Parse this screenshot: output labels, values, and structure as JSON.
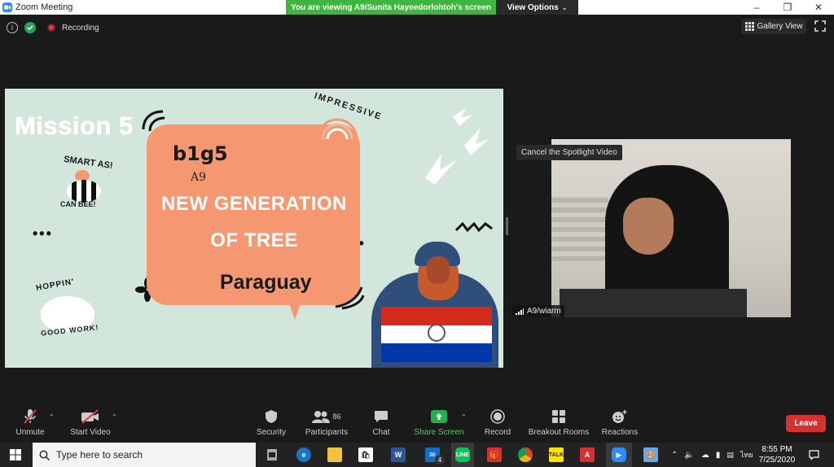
{
  "window": {
    "title": "Zoom Meeting"
  },
  "share_banner": {
    "text": "You are viewing A9/Sunita Hayeedorlohtoh's screen",
    "view_options_label": "View Options"
  },
  "meeting": {
    "recording_label": "Recording",
    "gallery_view_label": "Gallery View"
  },
  "slide": {
    "mission": "Mission 5",
    "group": "b1g5",
    "class": "A9",
    "line1": "NEW GENERATION",
    "line2": "OF TREE",
    "country": "Paraguay",
    "sticker_smart": "SMART AS!",
    "sticker_canbee": "CAN BEE!",
    "sticker_hoppin": "HOPPIN'",
    "sticker_goodwork": "GOOD WORK!",
    "sticker_impressive": "IMPRESSIVE",
    "flag_colors": [
      "#d52b1e",
      "#ffffff",
      "#0038a8"
    ]
  },
  "video": {
    "cancel_spotlight": "Cancel the Spotlight Video",
    "participant_name": "A9/wiarm"
  },
  "toolbar": {
    "unmute": "Unmute",
    "start_video": "Start Video",
    "security": "Security",
    "participants": "Participants",
    "participants_count": "86",
    "chat": "Chat",
    "share_screen": "Share Screen",
    "record": "Record",
    "breakout_rooms": "Breakout Rooms",
    "reactions": "Reactions",
    "leave": "Leave"
  },
  "taskbar": {
    "search_placeholder": "Type here to search",
    "mail_badge": "4",
    "language": "ไทย",
    "time": "8:55 PM",
    "date": "7/25/2020"
  },
  "colors": {
    "share_green": "#3fb43f",
    "leave_red": "#d8302f",
    "share_icon_green": "#22b14c",
    "zoom_blue": "#2d8cff"
  }
}
